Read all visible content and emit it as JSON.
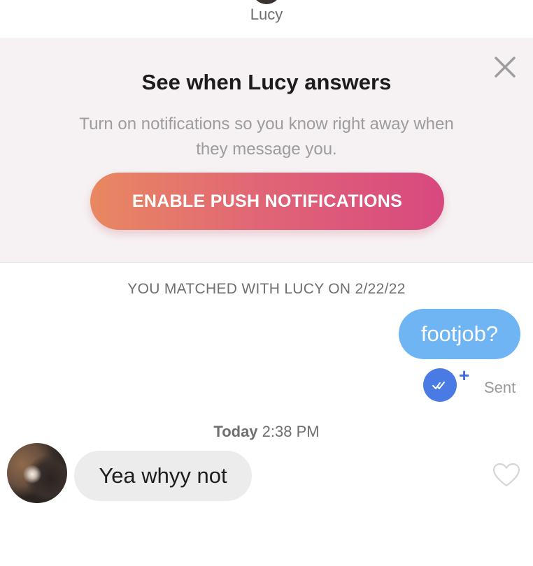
{
  "header": {
    "contact_name": "Lucy"
  },
  "banner": {
    "title": "See when Lucy answers",
    "text": "Turn on notifications so you know right away when they message you.",
    "button_label": "ENABLE PUSH NOTIFICATIONS",
    "close_icon": "close-icon"
  },
  "chat": {
    "matched_text": "YOU MATCHED WITH LUCY ON 2/22/22",
    "outgoing": {
      "text": "footjob?",
      "status": "Sent",
      "read_badge_icon": "double-check-icon",
      "plus_mark": "+"
    },
    "timestamp": {
      "day": "Today",
      "time": "2:38 PM"
    },
    "incoming": {
      "text": "Yea whyy not",
      "like_icon": "heart-outline-icon"
    }
  },
  "colors": {
    "banner_bg": "#f6f2f3",
    "button_gradient_start": "#e98861",
    "button_gradient_end": "#d8487f",
    "outgoing_bubble": "#6fb5f4",
    "incoming_bubble": "#ececec",
    "read_badge": "#4a7be4"
  }
}
